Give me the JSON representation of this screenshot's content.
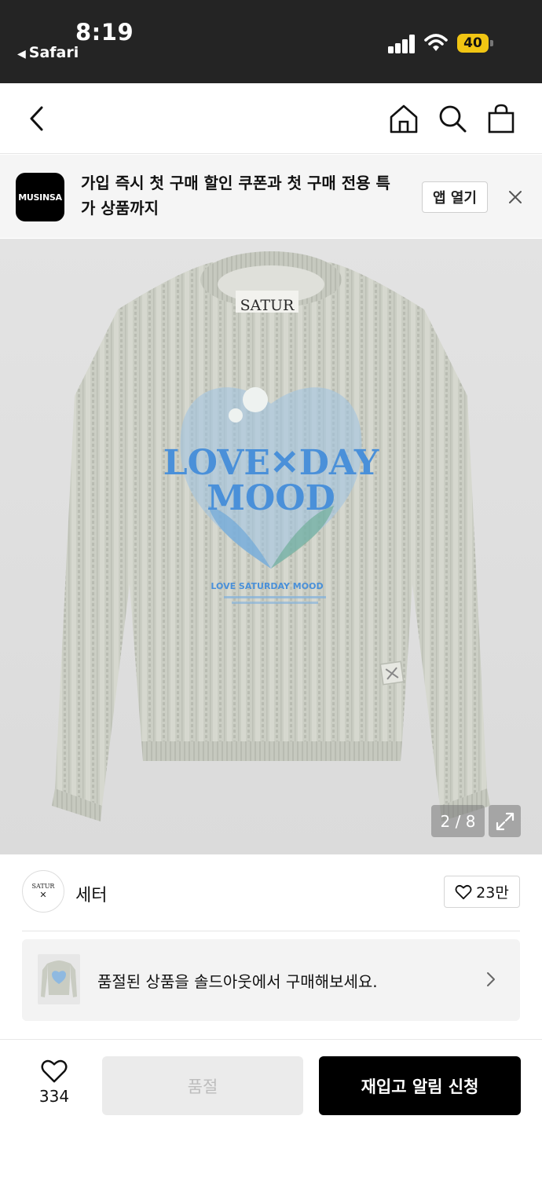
{
  "status_bar": {
    "time": "8:19",
    "back_app": "Safari",
    "battery": "40"
  },
  "nav": {
    "icons": [
      "back-icon",
      "home-icon",
      "search-icon",
      "shopping-bag-icon"
    ]
  },
  "app_banner": {
    "logo_text": "MUSINSA",
    "message": "가입 즉시 첫 구매 할인 쿠폰과 첫 구매 전용 특가 상품까지",
    "open_label": "앱 열기"
  },
  "product_image": {
    "counter": "2 / 8",
    "current": 2,
    "total": 8,
    "neck_label": "SATUR",
    "print_title_1": "LOVE✕DAY",
    "print_title_2": "MOOD",
    "print_sub": "LOVE SATURDAY MOOD"
  },
  "brand": {
    "avatar_text": "SATUR",
    "name": "세터",
    "likes": "23만"
  },
  "soldout_banner": {
    "message": "품절된 상품을 솔드아웃에서 구매해보세요."
  },
  "bottom_bar": {
    "wish_count": "334",
    "soldout_label": "품절",
    "restock_label": "재입고 알림 신청"
  },
  "colors": {
    "status_bg": "#242424",
    "battery": "#f1c513",
    "restock_button": "#000000",
    "soldout_button": "#ebebeb",
    "sweater": "#c9ccc2",
    "print_blue": "#4a90d9"
  }
}
